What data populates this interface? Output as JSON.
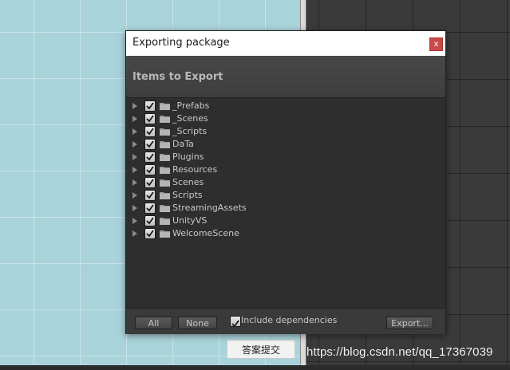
{
  "dialog": {
    "title": "Exporting package",
    "close_glyph": "x",
    "header": "Items to Export",
    "items": [
      {
        "label": "_Prefabs",
        "checked": true
      },
      {
        "label": "_Scenes",
        "checked": true
      },
      {
        "label": "_Scripts",
        "checked": true
      },
      {
        "label": "DaTa",
        "checked": true
      },
      {
        "label": "Plugins",
        "checked": true
      },
      {
        "label": "Resources",
        "checked": true
      },
      {
        "label": "Scenes",
        "checked": true
      },
      {
        "label": "Scripts",
        "checked": true
      },
      {
        "label": "StreamingAssets",
        "checked": true
      },
      {
        "label": "UnityVS",
        "checked": true
      },
      {
        "label": "WelcomeScene",
        "checked": true
      }
    ],
    "footer": {
      "all_label": "All",
      "none_label": "None",
      "include_dependencies_label": "Include dependencies",
      "include_dependencies_checked": true,
      "export_label": "Export..."
    }
  },
  "background": {
    "submit_button_label": "答案提交",
    "watermark": "https://blog.csdn.net/qq_17367039"
  },
  "colors": {
    "scene_bg": "#a9d3da",
    "dialog_bg": "#3c3c3c",
    "tree_bg": "#2e2e2e",
    "close_button": "#c94a4a"
  }
}
